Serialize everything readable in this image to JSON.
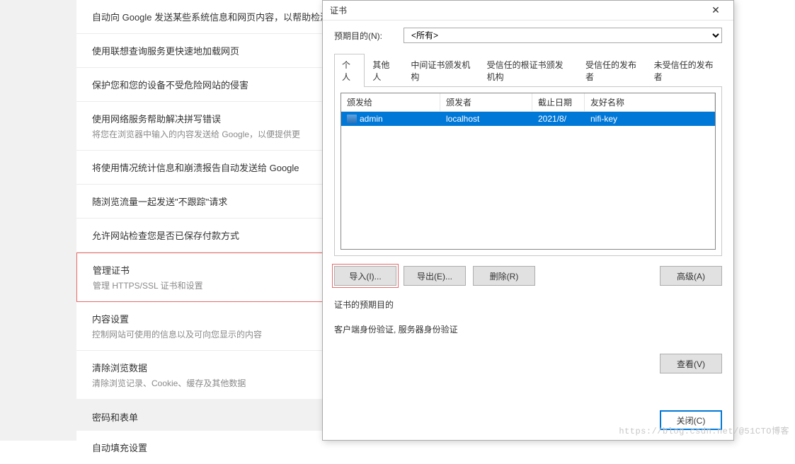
{
  "settings": {
    "items": [
      {
        "title": "自动向 Google 发送某些系统信息和网页内容，以帮助检测危险应用和网站",
        "sub": ""
      },
      {
        "title": "使用联想查询服务更快速地加载网页",
        "sub": ""
      },
      {
        "title": "保护您和您的设备不受危险网站的侵害",
        "sub": ""
      },
      {
        "title": "使用网络服务帮助解决拼写错误",
        "sub": "将您在浏览器中输入的内容发送给 Google，以便提供更"
      },
      {
        "title": "将使用情况统计信息和崩溃报告自动发送给 Google",
        "sub": ""
      },
      {
        "title": "随浏览流量一起发送\"不跟踪\"请求",
        "sub": ""
      },
      {
        "title": "允许网站检查您是否已保存付款方式",
        "sub": ""
      },
      {
        "title": "管理证书",
        "sub": "管理 HTTPS/SSL 证书和设置"
      },
      {
        "title": "内容设置",
        "sub": "控制网站可使用的信息以及可向您显示的内容"
      },
      {
        "title": "清除浏览数据",
        "sub": "清除浏览记录、Cookie、缓存及其他数据"
      }
    ],
    "section_pw": "密码和表单",
    "autofill": "自动填充设置"
  },
  "dialog": {
    "title": "证书",
    "filter_label": "预期目的(N):",
    "filter_value": "<所有>",
    "tabs": [
      "个人",
      "其他人",
      "中间证书颁发机构",
      "受信任的根证书颁发机构",
      "受信任的发布者",
      "未受信任的发布者"
    ],
    "cols": {
      "a": "颁发给",
      "b": "颁发者",
      "c": "截止日期",
      "d": "友好名称"
    },
    "row": {
      "a": "admin",
      "b": "localhost",
      "c": "2021/8/",
      "d": "nifi-key"
    },
    "btn_import": "导入(I)...",
    "btn_export": "导出(E)...",
    "btn_delete": "删除(R)",
    "btn_advanced": "高级(A)",
    "purpose_label": "证书的预期目的",
    "purpose_text": "客户端身份验证, 服务器身份验证",
    "btn_view": "查看(V)",
    "btn_close": "关闭(C)"
  },
  "watermark": "https://blog.csdn.net/@51CTO博客"
}
